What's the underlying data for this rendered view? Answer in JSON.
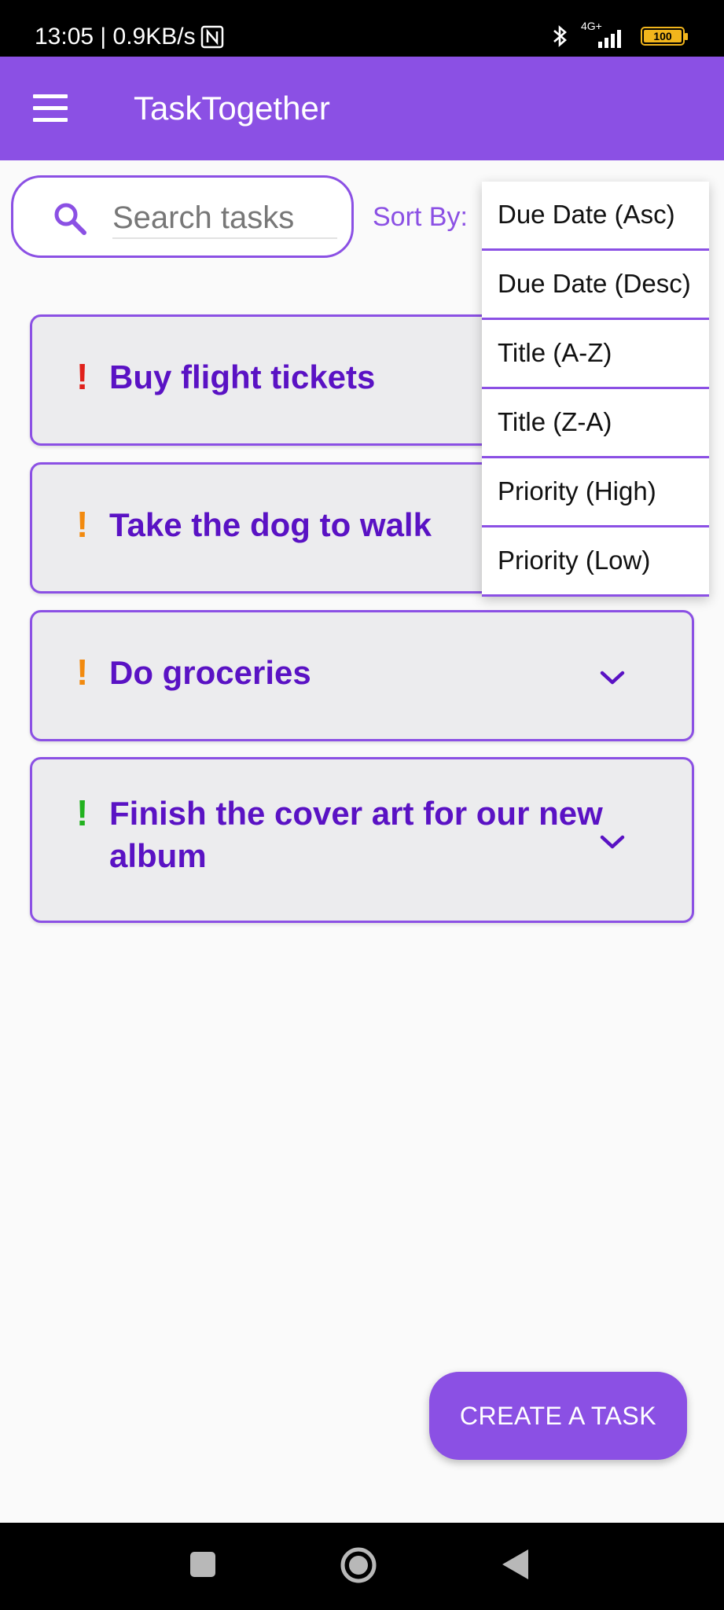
{
  "status_bar": {
    "time_speed": "13:05 | 0.9KB/s",
    "network": "4G+",
    "battery": "100",
    "icons": [
      "nfc-icon",
      "bluetooth-icon",
      "signal-icon",
      "battery-icon"
    ]
  },
  "app_bar": {
    "title": "TaskTogether",
    "menu_icon": "menu-icon"
  },
  "search": {
    "placeholder": "Search tasks",
    "value": "",
    "icon": "search-icon"
  },
  "sort": {
    "label": "Sort By:",
    "options": [
      "Due Date (Asc)",
      "Due Date (Desc)",
      "Title (A-Z)",
      "Title (Z-A)",
      "Priority (High)",
      "Priority (Low)"
    ]
  },
  "tasks": [
    {
      "title": "Buy flight tickets",
      "priority": "high",
      "mark": "!",
      "color": "#e0211b"
    },
    {
      "title": "Take the dog to walk",
      "priority": "medium",
      "mark": "!",
      "color": "#f28a0f"
    },
    {
      "title": "Do groceries",
      "priority": "medium",
      "mark": "!",
      "color": "#f28a0f"
    },
    {
      "title": "Finish the cover art for our new album",
      "priority": "low",
      "mark": "!",
      "color": "#22b21f"
    }
  ],
  "create_button": {
    "label": "CREATE A TASK"
  },
  "colors": {
    "primary": "#8b50e4",
    "task_title": "#5a12c4",
    "card_background": "#ececee"
  }
}
